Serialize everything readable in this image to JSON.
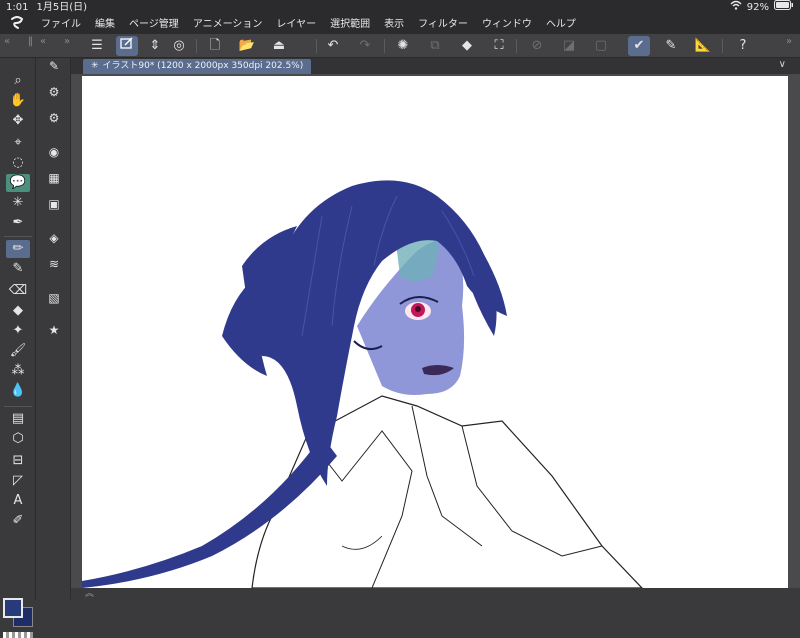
{
  "status": {
    "time": "1:01",
    "date": "1月5日(日)",
    "battery": "92%"
  },
  "menu": {
    "items": [
      "ファイル",
      "編集",
      "ページ管理",
      "アニメーション",
      "レイヤー",
      "選択範囲",
      "表示",
      "フィルター",
      "ウィンドウ",
      "ヘルプ"
    ]
  },
  "document": {
    "tab_title": "イラスト90* (1200 x 2000px 350dpi 202.5%)"
  },
  "colors": {
    "main_color": "#283a7a",
    "sub_color": "#1f2c66",
    "accent": "#5a6d8f",
    "hair": "#2f3a8c",
    "skin": "#8f97d9"
  }
}
